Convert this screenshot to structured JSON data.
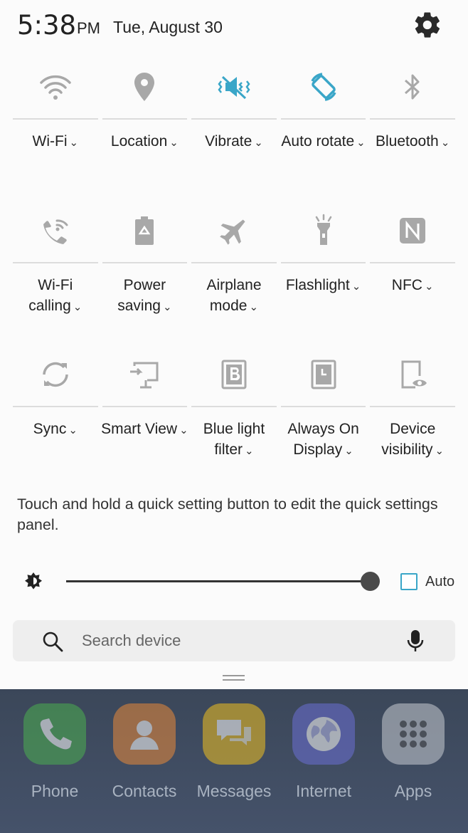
{
  "status": {
    "time": "5:38",
    "ampm": "PM",
    "date": "Tue, August 30"
  },
  "quick_settings": [
    [
      {
        "label": "Wi-Fi",
        "chevron": "⌄",
        "icon": "wifi-icon",
        "active": false
      },
      {
        "label": "Location",
        "chevron": "⌄",
        "icon": "location-icon",
        "active": false
      },
      {
        "label": "Vibrate",
        "chevron": "⌄",
        "icon": "vibrate-icon",
        "active": true
      },
      {
        "label": "Auto rotate",
        "chevron": "⌄",
        "icon": "auto-rotate-icon",
        "active": true
      },
      {
        "label": "Bluetooth",
        "chevron": "⌄",
        "icon": "bluetooth-icon",
        "active": false
      }
    ],
    [
      {
        "label": "Wi-Fi calling",
        "chevron": "⌄",
        "icon": "wifi-calling-icon",
        "active": false
      },
      {
        "label": "Power saving",
        "chevron": "⌄",
        "icon": "power-saving-icon",
        "active": false
      },
      {
        "label": "Airplane mode",
        "chevron": "⌄",
        "icon": "airplane-icon",
        "active": false
      },
      {
        "label": "Flashlight",
        "chevron": "⌄",
        "icon": "flashlight-icon",
        "active": false
      },
      {
        "label": "NFC",
        "chevron": "⌄",
        "icon": "nfc-icon",
        "active": false
      }
    ],
    [
      {
        "label": "Sync",
        "chevron": "⌄",
        "icon": "sync-icon",
        "active": false
      },
      {
        "label": "Smart View",
        "chevron": "⌄",
        "icon": "smart-view-icon",
        "active": false
      },
      {
        "label": "Blue light filter",
        "chevron": "⌄",
        "icon": "blue-light-filter-icon",
        "active": false
      },
      {
        "label": "Always On Display",
        "chevron": "⌄",
        "icon": "always-on-display-icon",
        "active": false
      },
      {
        "label": "Device visibility",
        "chevron": "⌄",
        "icon": "device-visibility-icon",
        "active": false
      }
    ]
  ],
  "hint": "Touch and hold a quick setting button to edit the quick settings panel.",
  "brightness": {
    "level": 1.0,
    "auto_label": "Auto",
    "auto_checked": false
  },
  "search": {
    "placeholder": "Search device"
  },
  "dock": [
    {
      "label": "Phone",
      "icon": "phone-icon",
      "color": "#4caf50"
    },
    {
      "label": "Contacts",
      "icon": "contacts-icon",
      "color": "#e8893a"
    },
    {
      "label": "Messages",
      "icon": "messages-icon",
      "color": "#f0c020"
    },
    {
      "label": "Internet",
      "icon": "internet-icon",
      "color": "#6b6fd4"
    },
    {
      "label": "Apps",
      "icon": "apps-icon",
      "color": "#c8ccd2"
    }
  ],
  "colors": {
    "accent": "#3aa6c8",
    "icon_inactive": "#a8a8a8"
  }
}
